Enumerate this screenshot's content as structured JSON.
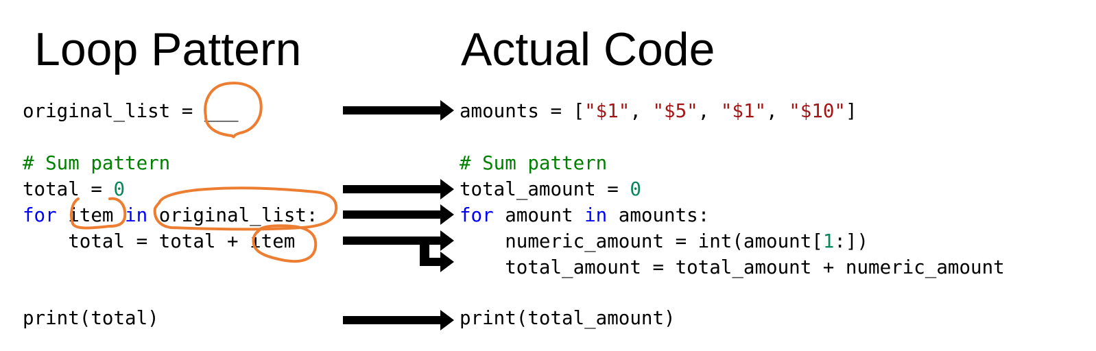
{
  "titles": {
    "left": "Loop Pattern",
    "right": "Actual Code"
  },
  "left_code": {
    "line1": {
      "text": "original_list = ___"
    },
    "line2": {
      "comment": "# Sum pattern"
    },
    "line3": {
      "a": "total = ",
      "num": "0"
    },
    "line4": {
      "kw1": "for",
      "a": " item ",
      "kw2": "in",
      "b": " original_list:"
    },
    "line5": {
      "text": "    total = total + item"
    },
    "line6": {
      "text": "print(total)"
    }
  },
  "right_code": {
    "line1": {
      "a": "amounts = [",
      "s1": "\"$1\"",
      "c1": ", ",
      "s2": "\"$5\"",
      "c2": ", ",
      "s3": "\"$1\"",
      "c3": ", ",
      "s4": "\"$10\"",
      "end": "]"
    },
    "line2": {
      "comment": "# Sum pattern"
    },
    "line3": {
      "a": "total_amount = ",
      "num": "0"
    },
    "line4": {
      "kw1": "for",
      "a": " amount ",
      "kw2": "in",
      "b": " amounts:"
    },
    "line5": {
      "a": "    numeric_amount = int(amount[",
      "num": "1",
      "b": ":])"
    },
    "line6": {
      "text": "    total_amount = total_amount + numeric_amount"
    },
    "line7": {
      "text": "print(total_amount)"
    }
  },
  "colors": {
    "keyword": "#0000ff",
    "number": "#098658",
    "string": "#a31515",
    "comment": "#008000",
    "annotation": "#ed7d31",
    "arrow": "#000000"
  }
}
